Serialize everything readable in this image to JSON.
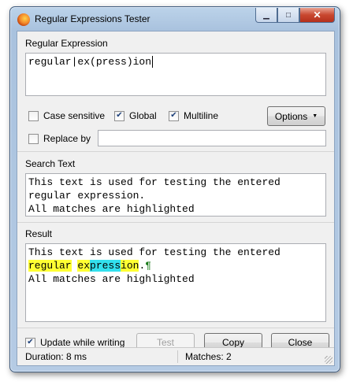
{
  "window": {
    "title": "Regular Expressions Tester"
  },
  "regex": {
    "label": "Regular Expression",
    "value": "regular|ex(press)ion"
  },
  "options": {
    "case_sensitive": {
      "label": "Case sensitive",
      "checked": false
    },
    "global": {
      "label": "Global",
      "checked": true
    },
    "multiline": {
      "label": "Multiline",
      "checked": true
    },
    "options_button": "Options"
  },
  "replace": {
    "label": "Replace by",
    "checked": false,
    "value": ""
  },
  "search_text": {
    "label": "Search Text",
    "lines": [
      "This text is used for testing the entered",
      "regular expression.",
      "All matches are highlighted"
    ]
  },
  "result": {
    "label": "Result",
    "line1": "This text is used for testing the entered",
    "line2": {
      "m1": "regular",
      "space": " ",
      "m2a": "ex",
      "m2b": "press",
      "m2c": "ion",
      "rest": ".",
      "pilcrow": "¶"
    },
    "line3": "All matches are highlighted",
    "colors": {
      "match": "#ffff33",
      "group": "#33e0ee"
    }
  },
  "footer": {
    "update_while_writing": {
      "label": "Update while writing",
      "checked": true
    },
    "test_button": "Test",
    "copy_button": "Copy",
    "close_button": "Close"
  },
  "status": {
    "duration": "Duration: 8 ms",
    "matches": "Matches: 2"
  }
}
